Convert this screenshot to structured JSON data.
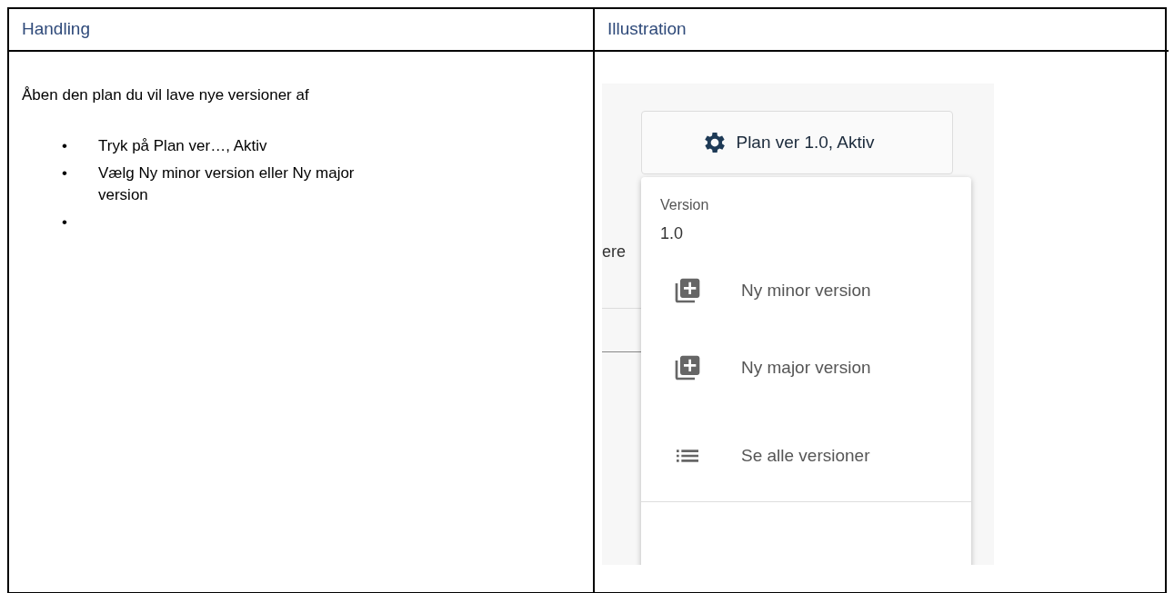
{
  "table": {
    "columns": [
      "Handling",
      "Illustration"
    ],
    "instructions": {
      "intro": "Åben den plan du vil lave nye versioner af",
      "bullets": [
        {
          "marker": "•",
          "text": "Tryk på Plan ver…, Aktiv"
        },
        {
          "marker": "•",
          "text": "Vælg Ny minor version eller Ny major version"
        },
        {
          "marker": "•"
        }
      ]
    },
    "illustration": {
      "background_text": "ere",
      "button": {
        "label": "Plan ver 1.0, Aktiv"
      },
      "menu": {
        "section_label": "Version",
        "section_value": "1.0",
        "items": [
          {
            "kind": "add",
            "label": "Ny minor version"
          },
          {
            "kind": "add",
            "label": "Ny major version"
          },
          {
            "kind": "list",
            "label": "Se alle versioner"
          }
        ]
      }
    }
  }
}
